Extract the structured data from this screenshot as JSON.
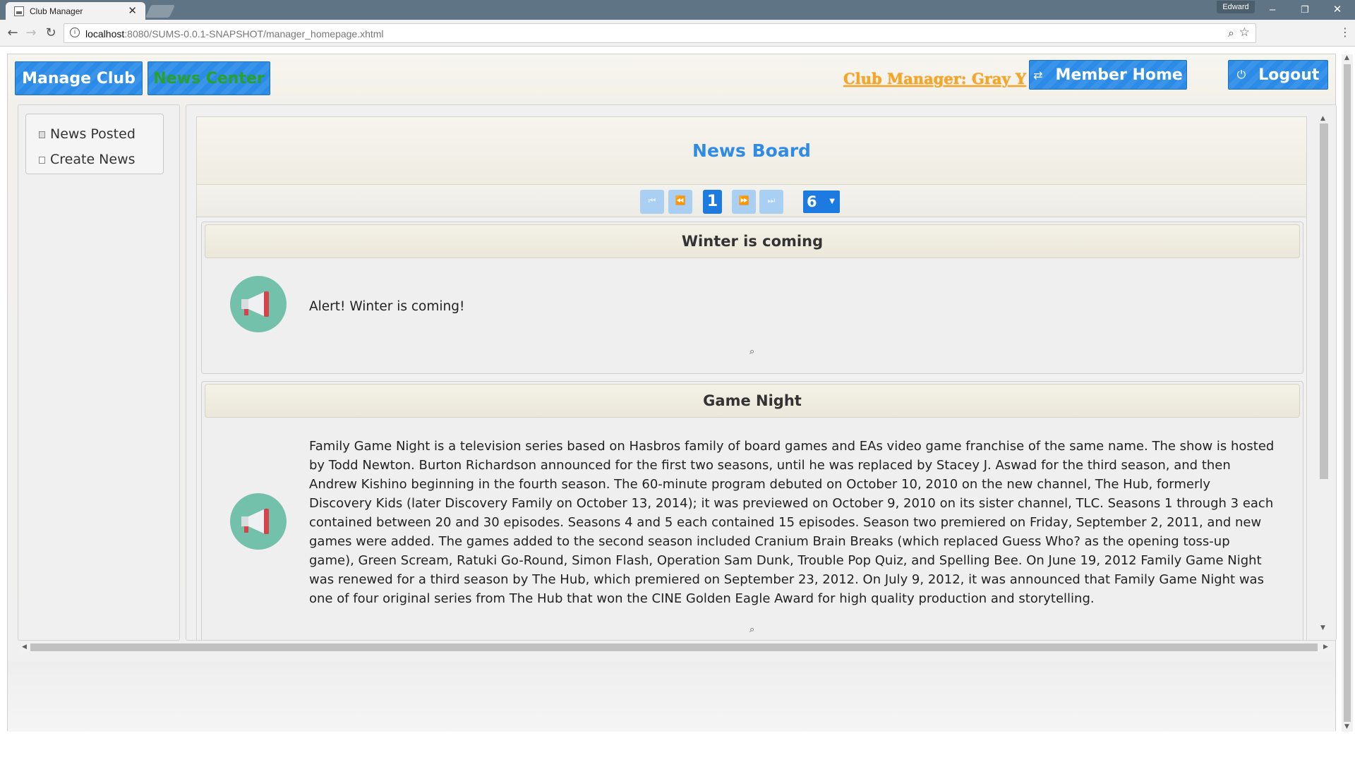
{
  "browser": {
    "tab_title": "Club Manager",
    "tab_close": "✕",
    "profile_name": "Edward",
    "url_host": "localhost",
    "url_rest": ":8080/SUMS-0.0.1-SNAPSHOT/manager_homepage.xhtml",
    "window_controls": [
      "–",
      "❐",
      "✕"
    ],
    "icons": {
      "back": "back-arrow-icon",
      "forward": "forward-arrow-icon",
      "reload": "reload-icon",
      "info": "info-icon",
      "zoom": "zoom-icon",
      "star": "bookmark-star-icon",
      "menu": "kebab-menu-icon"
    }
  },
  "menubar": {
    "manage_club": "Manage Club",
    "news_center": "News Center",
    "club_manager_label": "Club Manager: Gray Y",
    "member_home": "Member Home",
    "logout": "Logout",
    "active_tab_color": "#2aa12a",
    "link_color": "#f5a623"
  },
  "sidebar": {
    "items": [
      {
        "label": "News Posted"
      },
      {
        "label": "Create News"
      }
    ]
  },
  "news_board": {
    "title": "News Board",
    "paginator": {
      "current_page": "1",
      "rows_per_page": "6"
    },
    "items": [
      {
        "title": "Winter is coming",
        "body": "Alert! Winter is coming!"
      },
      {
        "title": "Game Night",
        "body": "Family Game Night is a television series based on Hasbros family of board games and EAs video game franchise of the same name. The show is hosted by Todd Newton. Burton Richardson announced for the first two seasons, until he was replaced by Stacey J. Aswad for the third season, and then Andrew Kishino beginning in the fourth season. The 60-minute program debuted on October 10, 2010 on the new channel, The Hub, formerly Discovery Kids (later Discovery Family on October 13, 2014); it was previewed on October 9, 2010 on its sister channel, TLC. Seasons 1 through 3 each contained between 20 and 30 episodes. Seasons 4 and 5 each contained 15 episodes. Season two premiered on Friday, September 2, 2011, and new games were added. The games added to the second season included Cranium Brain Breaks (which replaced Guess Who? as the opening toss-up game), Green Scream, Ratuki Go-Round, Simon Flash, Operation Sam Dunk, Trouble Pop Quiz, and Spelling Bee. On June 19, 2012 Family Game Night was renewed for a third season by The Hub, which premiered on September 23, 2012. On July 9, 2012, it was announced that Family Game Night was one of four original series from The Hub that won the CINE Golden Eagle Award for high quality production and storytelling."
      }
    ]
  },
  "colors": {
    "primary_blue": "#2b8be6",
    "title_blue": "#2f8be5",
    "icon_teal": "#73c0ab"
  }
}
